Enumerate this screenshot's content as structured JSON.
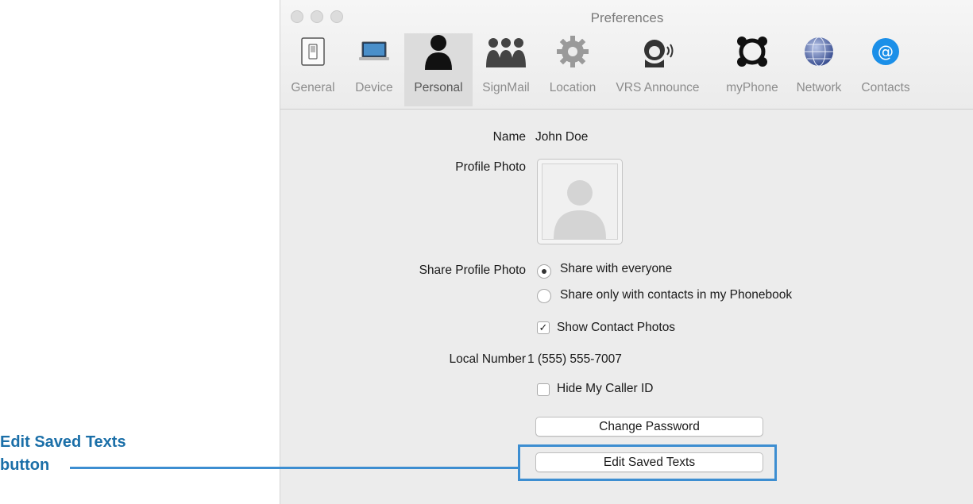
{
  "window": {
    "title": "Preferences"
  },
  "toolbar": {
    "tabs": [
      {
        "label": "General",
        "icon": "general-icon"
      },
      {
        "label": "Device",
        "icon": "device-icon"
      },
      {
        "label": "Personal",
        "icon": "personal-icon",
        "active": true
      },
      {
        "label": "SignMail",
        "icon": "signmail-icon"
      },
      {
        "label": "Location",
        "icon": "location-icon"
      },
      {
        "label": "VRS Announce",
        "icon": "vrs-announce-icon"
      },
      {
        "label": "myPhone",
        "icon": "myphone-icon"
      },
      {
        "label": "Network",
        "icon": "network-icon"
      },
      {
        "label": "Contacts",
        "icon": "contacts-icon"
      }
    ]
  },
  "personal": {
    "name_label": "Name",
    "name_value": "John Doe",
    "photo_label": "Profile Photo",
    "share_label": "Share Profile Photo",
    "share_options": [
      {
        "label": "Share with everyone",
        "selected": true
      },
      {
        "label": "Share only with contacts in my Phonebook",
        "selected": false
      }
    ],
    "show_contact_photos": {
      "label": "Show Contact Photos",
      "checked": true
    },
    "local_number_label": "Local Number",
    "local_number_value": "1 (555) 555-7007",
    "hide_caller_id": {
      "label": "Hide My Caller ID",
      "checked": false
    },
    "change_password_label": "Change Password",
    "edit_saved_texts_label": "Edit Saved Texts"
  },
  "callout": {
    "line1": "Edit Saved Texts",
    "line2": "button",
    "color": "#1b6fa8"
  }
}
